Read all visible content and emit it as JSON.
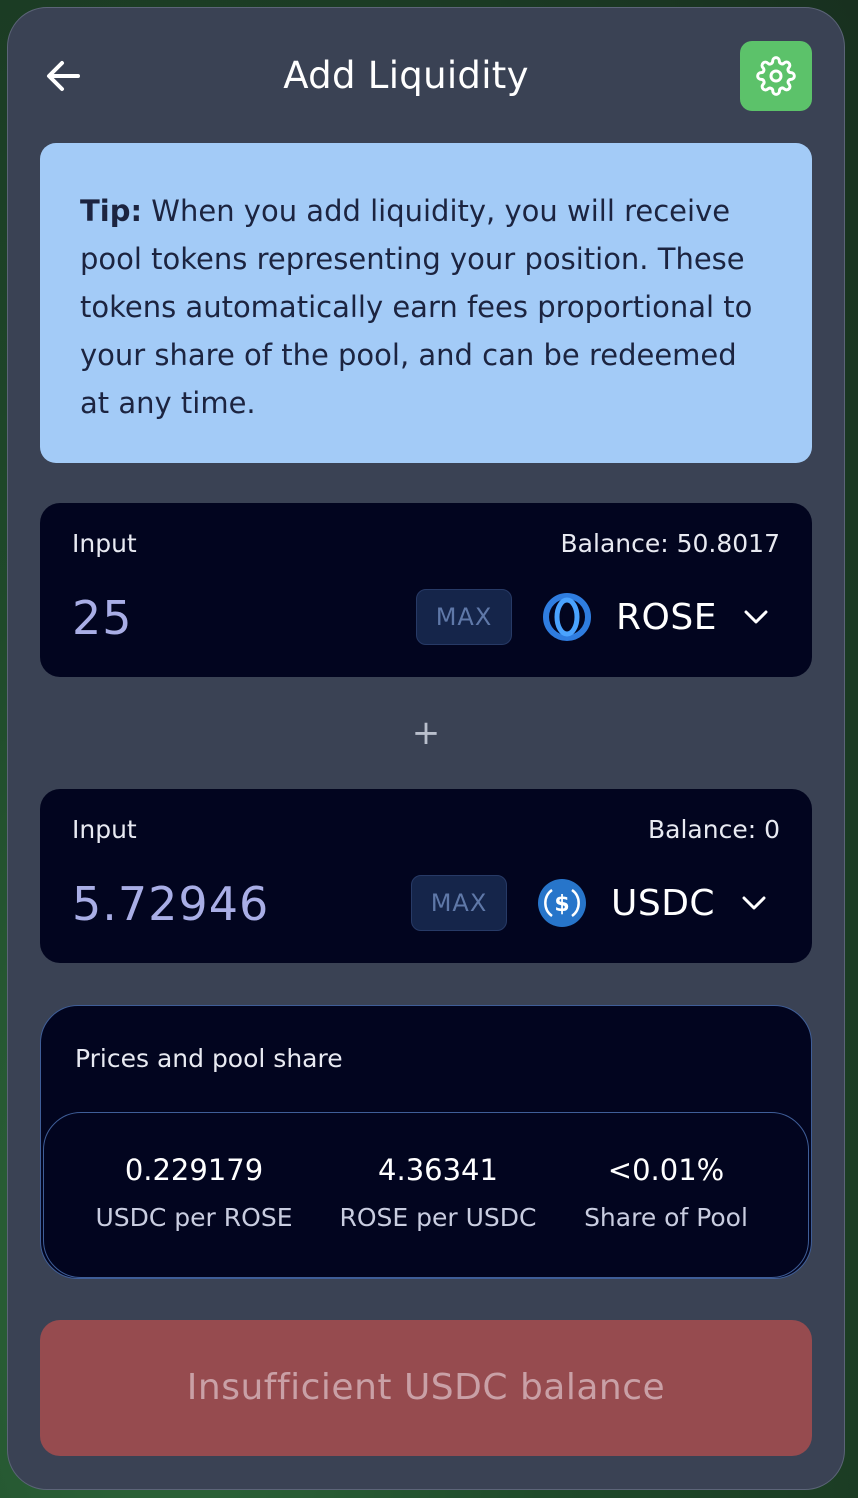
{
  "header": {
    "title": "Add Liquidity",
    "back_icon": "arrow-left-icon",
    "settings_icon": "gear-icon"
  },
  "tip": {
    "label": "Tip:",
    "text": " When you add liquidity, you will receive pool tokens representing your position. These tokens automatically earn fees proportional to your share of the pool, and can be redeemed at any time."
  },
  "input1": {
    "label": "Input",
    "balance": "Balance: 50.8017",
    "amount": "25",
    "max_label": "MAX",
    "token": "ROSE",
    "token_icon": "oasis-rose-icon"
  },
  "plus_symbol": "+",
  "input2": {
    "label": "Input",
    "balance": "Balance: 0",
    "amount": "5.72946",
    "max_label": "MAX",
    "token": "USDC",
    "token_icon": "usdc-icon"
  },
  "prices": {
    "title": "Prices and pool share",
    "stats": [
      {
        "value": "0.229179",
        "label": "USDC per ROSE"
      },
      {
        "value": "4.36341",
        "label": "ROSE per USDC"
      },
      {
        "value": "<0.01%",
        "label": "Share of Pool"
      }
    ]
  },
  "submit": {
    "label": "Insufficient USDC balance"
  },
  "colors": {
    "card_bg": "#3a4254",
    "tip_bg": "#a3cbf7",
    "panel_bg": "#02051f",
    "settings_green": "#5cc26a",
    "error_button": "#964b4f"
  }
}
